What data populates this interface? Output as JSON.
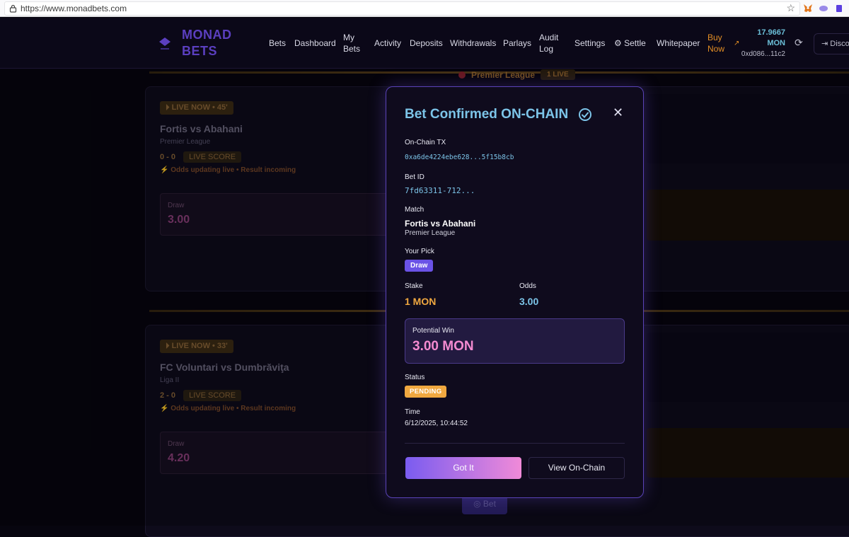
{
  "browser": {
    "url": "https://www.monadbets.com"
  },
  "nav": {
    "logo_line1": "MONAD",
    "logo_line2": "BETS",
    "items": {
      "bets": "Bets",
      "dashboard": "Dashboard",
      "my_bets_1": "My",
      "my_bets_2": "Bets",
      "activity": "Activity",
      "deposits": "Deposits",
      "withdrawals": "Withdrawals",
      "parlays": "Parlays",
      "audit_1": "Audit",
      "audit_2": "Log",
      "settings": "Settings",
      "settle": "Settle",
      "whitepaper": "Whitepaper",
      "buy_1": "Buy",
      "buy_2": "Now"
    },
    "balance_amount": "17.9667",
    "balance_unit": "MON",
    "address": "0xd086...11c2",
    "disconnect": "Disco"
  },
  "background": {
    "league_header": "Premier League",
    "league_live_count": "1 LIVE",
    "cards": [
      {
        "live_badge": "LIVE NOW • 45'",
        "match": "Fortis vs Abahani",
        "league": "Premier League",
        "score": "0 - 0",
        "score_chip": "LIVE SCORE",
        "odds_note": "Odds updating live • Result incoming",
        "odds_label": "Draw",
        "odds_value": "3.00"
      },
      {
        "live_badge": "LIVE NOW • 33'",
        "match": "FC Voluntari vs Dumbrăviţa",
        "league": "Liga II",
        "score": "2 - 0",
        "score_chip": "LIVE SCORE",
        "odds_note": "Odds updating live • Result incoming",
        "odds_label": "Draw",
        "odds_value": "4.20"
      }
    ],
    "bet_button": "Bet"
  },
  "modal": {
    "title": "Bet Confirmed ON-CHAIN",
    "tx_label": "On-Chain TX",
    "tx_value": "0xa6de4224ebe628...5f15b8cb",
    "bet_id_label": "Bet ID",
    "bet_id_value": "7fd63311-712...",
    "match_label": "Match",
    "match_value": "Fortis vs Abahani",
    "league_value": "Premier League",
    "pick_label": "Your Pick",
    "pick_value": "Draw",
    "stake_label": "Stake",
    "stake_value": "1 MON",
    "odds_label": "Odds",
    "odds_value": "3.00",
    "win_label": "Potential Win",
    "win_value": "3.00 MON",
    "status_label": "Status",
    "status_value": "PENDING",
    "time_label": "Time",
    "time_value": "6/12/2025, 10:44:52",
    "got_it": "Got It",
    "view_on_chain": "View On-Chain"
  },
  "colors": {
    "accent": "#7a5cf0",
    "title_cyan": "#7cc4e8",
    "stake_orange": "#f0a840",
    "win_pink": "#f38ad0"
  }
}
